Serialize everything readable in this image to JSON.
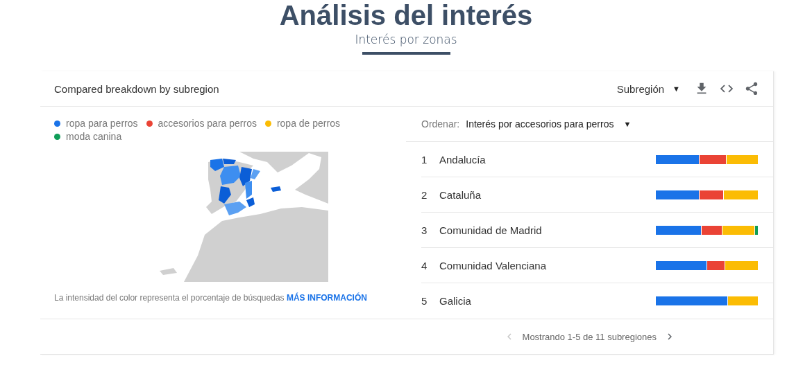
{
  "page": {
    "title": "Análisis del interés",
    "subtitle": "Interés por zonas"
  },
  "card": {
    "title": "Compared breakdown by subregion",
    "resolution": "Subregión",
    "resolution_caret": "▼"
  },
  "legend": [
    {
      "label": "ropa para perros",
      "color": "#1a73e8"
    },
    {
      "label": "accesorios para perros",
      "color": "#ea4335"
    },
    {
      "label": "ropa de perros",
      "color": "#fbbc04"
    },
    {
      "label": "moda canina",
      "color": "#0f9d58"
    }
  ],
  "note": {
    "text": "La intensidad del color representa el porcentaje de búsquedas",
    "link": "MÁS INFORMACIÓN"
  },
  "sort": {
    "label": "Ordenar:",
    "value": "Interés por accesorios para perros",
    "caret": "▼"
  },
  "rows": [
    {
      "rank": "1",
      "name": "Andalucía",
      "segments": [
        {
          "color": "#1a73e8"
        },
        {
          "color": "#ea4335"
        },
        {
          "color": "#fbbc04"
        }
      ]
    },
    {
      "rank": "2",
      "name": "Cataluña",
      "segments": [
        {
          "color": "#1a73e8"
        },
        {
          "color": "#ea4335"
        },
        {
          "color": "#fbbc04"
        }
      ]
    },
    {
      "rank": "3",
      "name": "Comunidad de Madrid",
      "segments": [
        {
          "color": "#1a73e8"
        },
        {
          "color": "#ea4335"
        },
        {
          "color": "#fbbc04"
        },
        {
          "color": "#0f9d58"
        }
      ]
    },
    {
      "rank": "4",
      "name": "Comunidad Valenciana",
      "segments": [
        {
          "color": "#1a73e8"
        },
        {
          "color": "#ea4335"
        },
        {
          "color": "#fbbc04"
        }
      ]
    },
    {
      "rank": "5",
      "name": "Galicia",
      "segments": [
        {
          "color": "#1a73e8"
        },
        {
          "color": "#fbbc04"
        }
      ]
    }
  ],
  "pagination": {
    "text": "Mostrando 1-5 de 11 subregiones",
    "prev_disabled": true,
    "next_disabled": false
  }
}
